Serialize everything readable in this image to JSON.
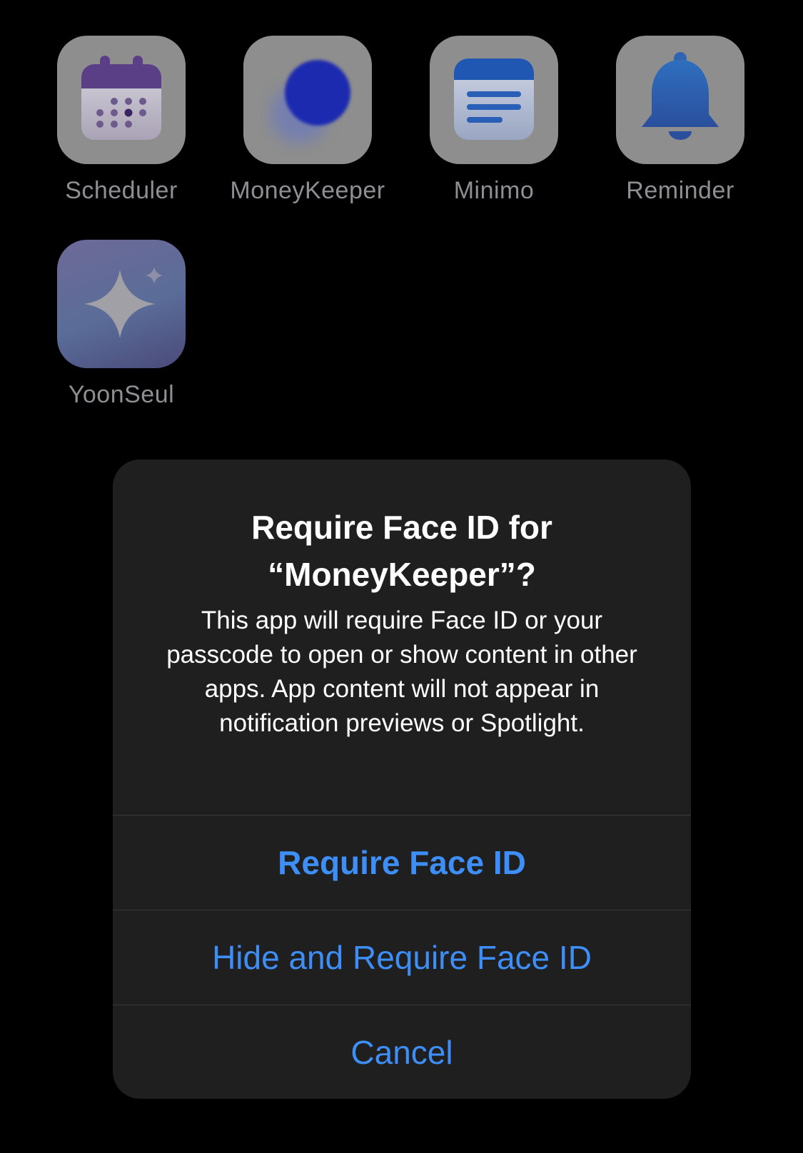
{
  "home": {
    "apps": [
      {
        "name": "Scheduler",
        "icon": "calendar-icon"
      },
      {
        "name": "MoneyKeeper",
        "icon": "blurred-coin-icon"
      },
      {
        "name": "Minimo",
        "icon": "notes-icon"
      },
      {
        "name": "Reminder",
        "icon": "bell-icon"
      },
      {
        "name": "YoonSeul",
        "icon": "sparkle-icon"
      }
    ]
  },
  "alert": {
    "title": "Require Face ID for “MoneyKeeper”?",
    "message": "This app will require Face ID or your passcode to open or show content in other apps. App content will not appear in notification previews or Spotlight.",
    "buttons": {
      "require": "Require Face ID",
      "hide_and_require": "Hide and Require Face ID",
      "cancel": "Cancel"
    }
  },
  "colors": {
    "accent": "#3e8ef7",
    "alert_background": "#1f1f1f",
    "label": "#8e8e93"
  }
}
